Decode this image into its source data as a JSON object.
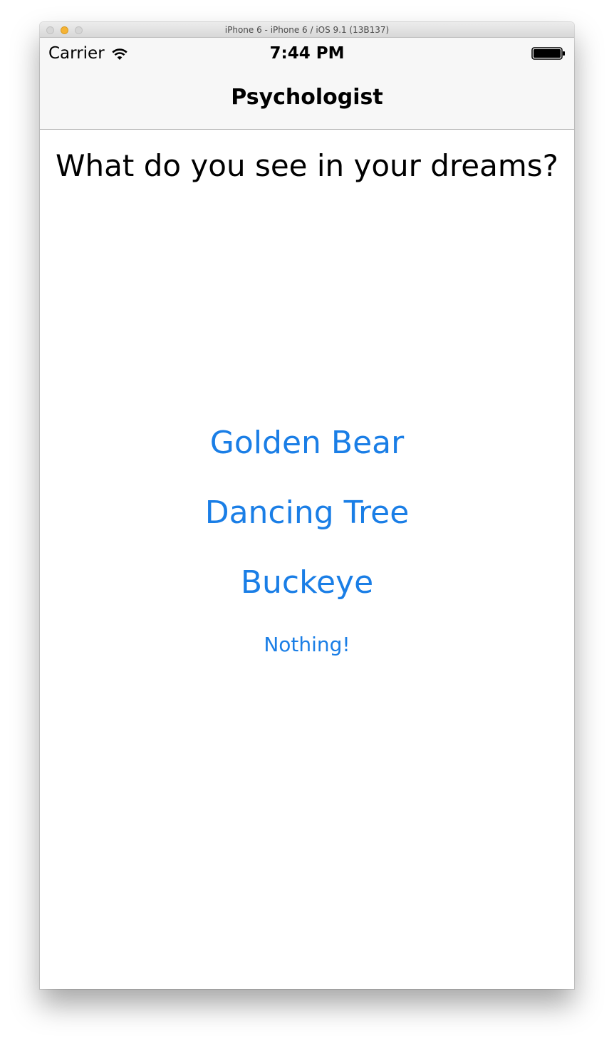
{
  "window": {
    "title": "iPhone 6 - iPhone 6 / iOS 9.1 (13B137)"
  },
  "status_bar": {
    "carrier": "Carrier",
    "time": "7:44 PM",
    "wifi_icon": "wifi-icon",
    "battery_icon": "battery-icon"
  },
  "nav_bar": {
    "title": "Psychologist"
  },
  "main": {
    "question": "What do you see in your dreams?",
    "answers": [
      {
        "label": "Golden Bear"
      },
      {
        "label": "Dancing Tree"
      },
      {
        "label": "Buckeye"
      },
      {
        "label": "Nothing!"
      }
    ]
  },
  "colors": {
    "accent": "#1a7ee6",
    "bar_background": "#f7f7f7"
  }
}
